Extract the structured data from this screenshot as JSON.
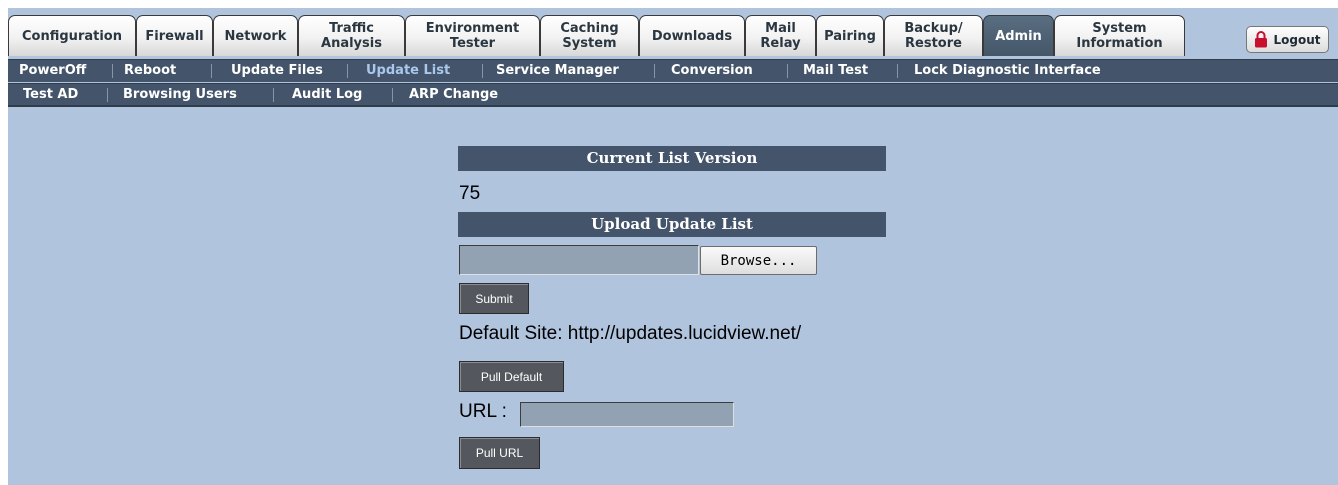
{
  "tabs": [
    {
      "label": "Configuration"
    },
    {
      "label": "Firewall"
    },
    {
      "label": "Network"
    },
    {
      "label": "Traffic\nAnalysis"
    },
    {
      "label": "Environment\nTester"
    },
    {
      "label": "Caching\nSystem"
    },
    {
      "label": "Downloads"
    },
    {
      "label": "Mail\nRelay"
    },
    {
      "label": "Pairing"
    },
    {
      "label": "Backup/\nRestore"
    },
    {
      "label": "Admin"
    },
    {
      "label": "System\nInformation"
    }
  ],
  "active_tab": "Admin",
  "logout_label": "Logout",
  "subnav_row1": [
    {
      "label": "PowerOff"
    },
    {
      "label": "Reboot"
    },
    {
      "label": "Update Files"
    },
    {
      "label": "Update List"
    },
    {
      "label": "Service Manager"
    },
    {
      "label": "Conversion"
    },
    {
      "label": "Mail Test"
    },
    {
      "label": "Lock Diagnostic Interface"
    }
  ],
  "subnav_row2": [
    {
      "label": "Test AD"
    },
    {
      "label": "Browsing Users"
    },
    {
      "label": "Audit Log"
    },
    {
      "label": "ARP Change"
    }
  ],
  "active_subnav": "Update List",
  "content": {
    "current_version_heading": "Current List Version",
    "current_version_value": "75",
    "upload_heading": "Upload Update List",
    "file_input_value": "",
    "browse_label": "Browse...",
    "submit_label": "Submit",
    "default_site_text": "Default Site: http://updates.lucidview.net/",
    "pull_default_label": "Pull Default",
    "url_label": "URL :",
    "url_input_value": "",
    "pull_url_label": "Pull URL"
  },
  "colors": {
    "page_background": "#b0c4de",
    "nav_background": "#44546a",
    "active_subnav_text": "#a9c8ec",
    "button_background": "#54585e",
    "logout_lock": "#c8102e"
  }
}
